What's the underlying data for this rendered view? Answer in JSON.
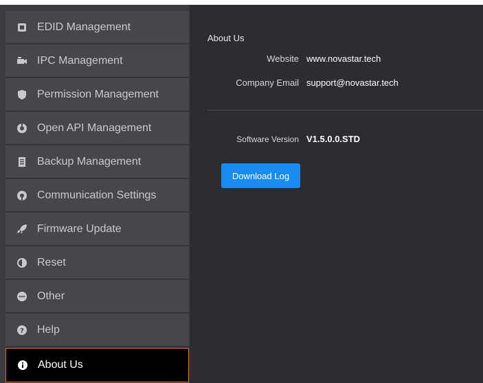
{
  "sidebar": {
    "items": [
      {
        "label": "EDID Management",
        "icon": "edid-icon"
      },
      {
        "label": "IPC Management",
        "icon": "ipc-icon"
      },
      {
        "label": "Permission Management",
        "icon": "shield-icon"
      },
      {
        "label": "Open API Management",
        "icon": "api-icon"
      },
      {
        "label": "Backup Management",
        "icon": "backup-icon"
      },
      {
        "label": "Communication Settings",
        "icon": "communication-icon"
      },
      {
        "label": "Firmware Update",
        "icon": "rocket-icon"
      },
      {
        "label": "Reset",
        "icon": "reset-icon"
      },
      {
        "label": "Other",
        "icon": "other-icon"
      },
      {
        "label": "Help",
        "icon": "help-icon"
      },
      {
        "label": "About Us",
        "icon": "info-icon",
        "active": true
      }
    ]
  },
  "main": {
    "section_title": "About Us",
    "website_label": "Website",
    "website_value": "www.novastar.tech",
    "email_label": "Company Email",
    "email_value": "support@novastar.tech",
    "version_label": "Software Version",
    "version_value": "V1.5.0.0.STD",
    "download_button": "Download Log"
  },
  "colors": {
    "sidebar_bg": "#46464d",
    "active_bg": "#000000",
    "active_border": "#c8702c",
    "content_bg": "#2c2c33",
    "button_bg": "#1a8cf0"
  }
}
